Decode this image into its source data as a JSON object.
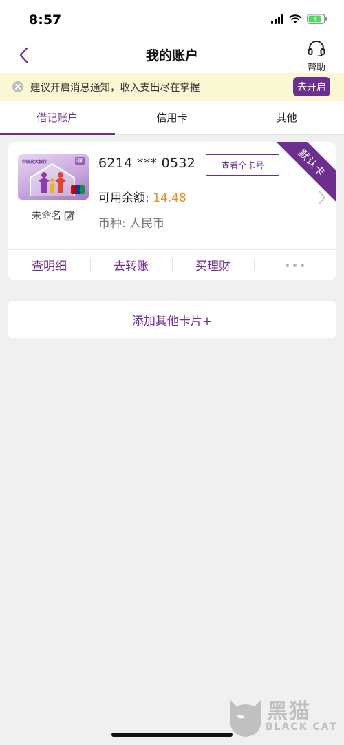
{
  "status_bar": {
    "time": "8:57"
  },
  "header": {
    "title": "我的账户",
    "help_label": "帮助"
  },
  "notice": {
    "text": "建议开启消息通知，收入支出尽在掌握",
    "button": "去开启"
  },
  "tabs": [
    {
      "label": "借记账户",
      "active": true
    },
    {
      "label": "信用卡",
      "active": false
    },
    {
      "label": "其他",
      "active": false
    }
  ],
  "card": {
    "number": "6214 *** 0532",
    "view_full_label": "查看全卡号",
    "balance_label": "可用余额: ",
    "balance_value": "14.48",
    "currency": "币种: 人民币",
    "name": "未命名",
    "default_badge": "默认卡",
    "card_bank_text": "中国光大银行",
    "card_product_text": "i家"
  },
  "card_actions": [
    {
      "label": "查明细"
    },
    {
      "label": "去转账"
    },
    {
      "label": "买理财"
    }
  ],
  "add_card_label": "添加其他卡片+",
  "watermark": {
    "cn": "黑猫",
    "en": "BLACK CAT"
  },
  "colors": {
    "accent": "#6d2f8e",
    "balance": "#e0922b",
    "notice_bg": "#faf8d2"
  },
  "icons": [
    "back-icon",
    "headset-icon",
    "close-icon",
    "edit-icon",
    "chevron-right-icon",
    "more-icon"
  ]
}
